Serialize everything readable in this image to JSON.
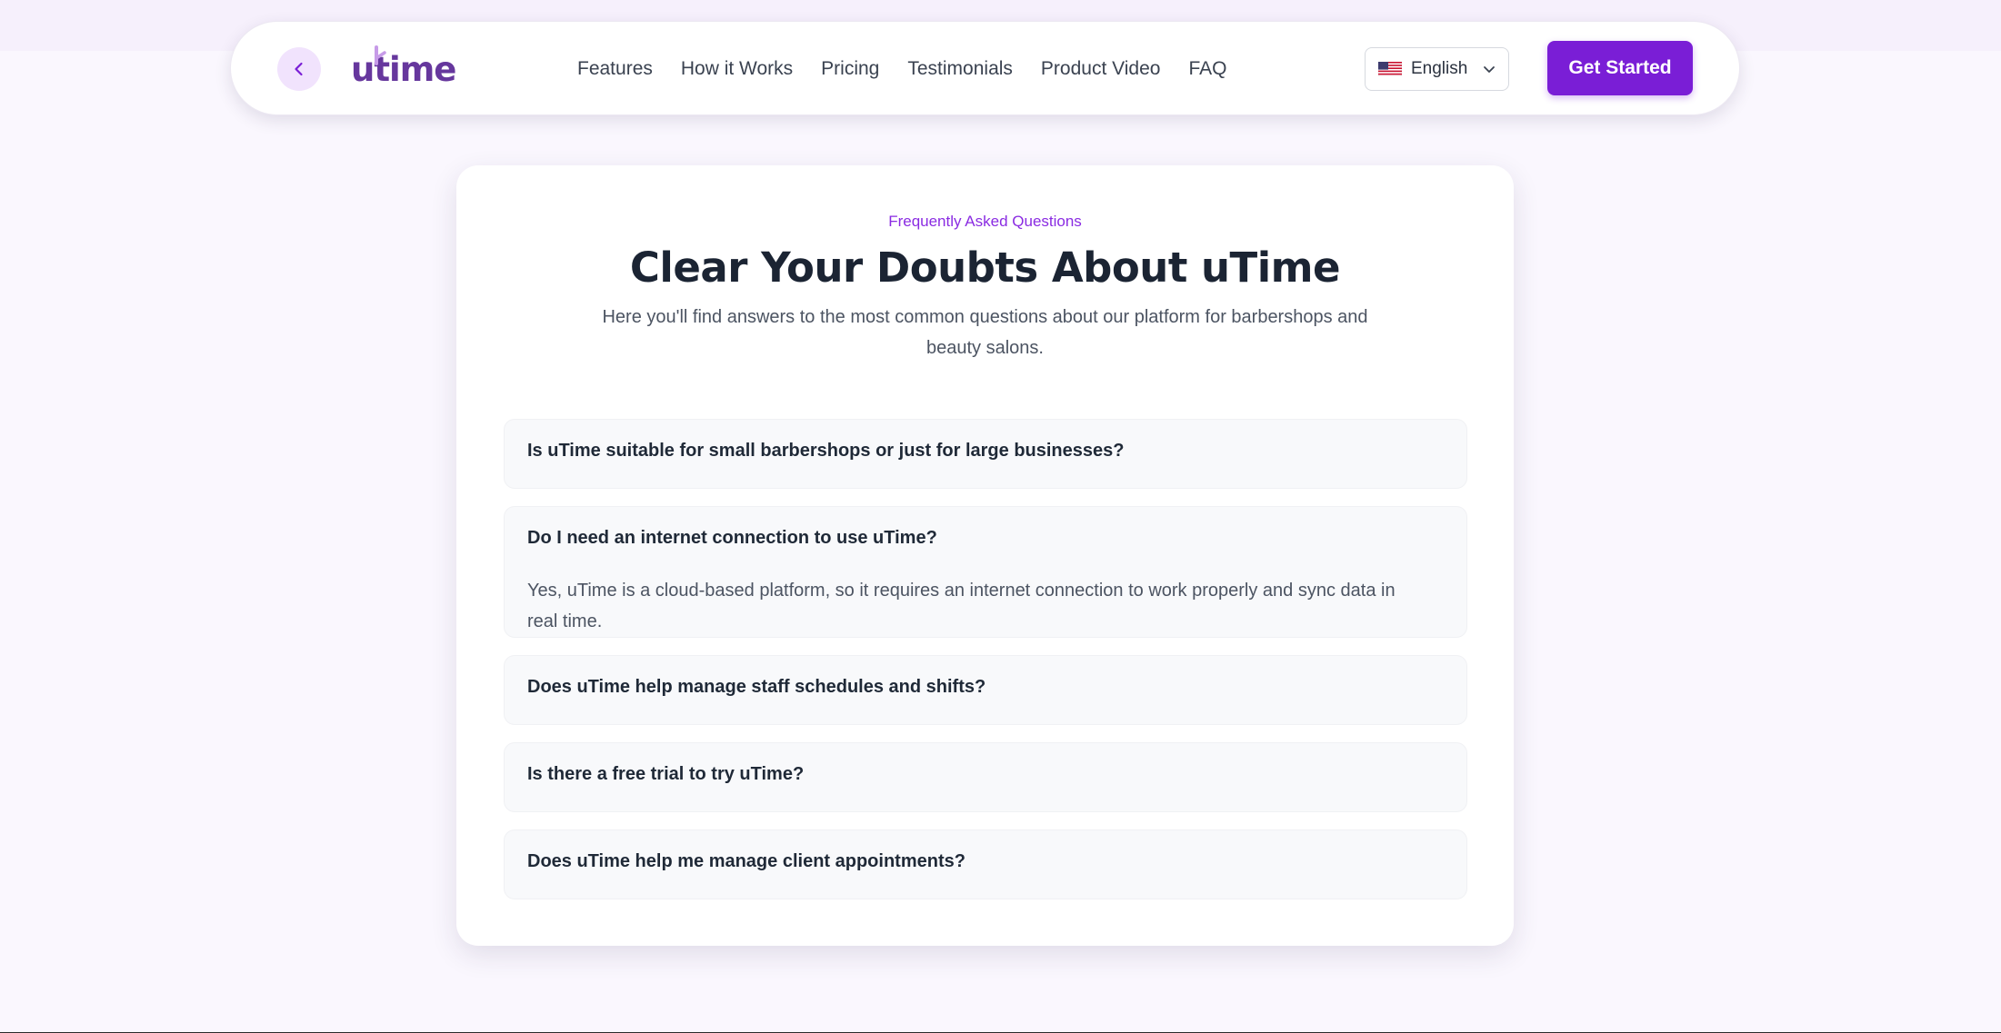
{
  "nav": {
    "brand": "utime",
    "links": [
      {
        "label": "Features"
      },
      {
        "label": "How it Works"
      },
      {
        "label": "Pricing"
      },
      {
        "label": "Testimonials"
      },
      {
        "label": "Product Video"
      },
      {
        "label": "FAQ"
      }
    ],
    "language": {
      "selected": "English",
      "flag": "us-flag-icon"
    },
    "cta_label": "Get Started",
    "back_icon": "chevron-left-icon"
  },
  "faq": {
    "eyebrow": "Frequently Asked Questions",
    "title": "Clear Your Doubts About uTime",
    "subtitle": "Here you'll find answers to the most common questions about our platform for barbershops and beauty salons.",
    "items": [
      {
        "question": "Is uTime suitable for small barbershops or just for large businesses?",
        "expanded": false
      },
      {
        "question": "Do I need an internet connection to use uTime?",
        "answer": "Yes, uTime is a cloud-based platform, so it requires an internet connection to work properly and sync data in real time.",
        "expanded": true
      },
      {
        "question": "Does uTime help manage staff schedules and shifts?",
        "expanded": false
      },
      {
        "question": "Is there a free trial to try uTime?",
        "expanded": false
      },
      {
        "question": "Does uTime help me manage client appointments?",
        "expanded": false
      }
    ]
  },
  "colors": {
    "brand": "#7a1ed6",
    "logo": "#66379d",
    "eyebrow": "#8a2be2",
    "page_background": "#faf7fe",
    "faq_item_background": "#f8f9fb"
  }
}
